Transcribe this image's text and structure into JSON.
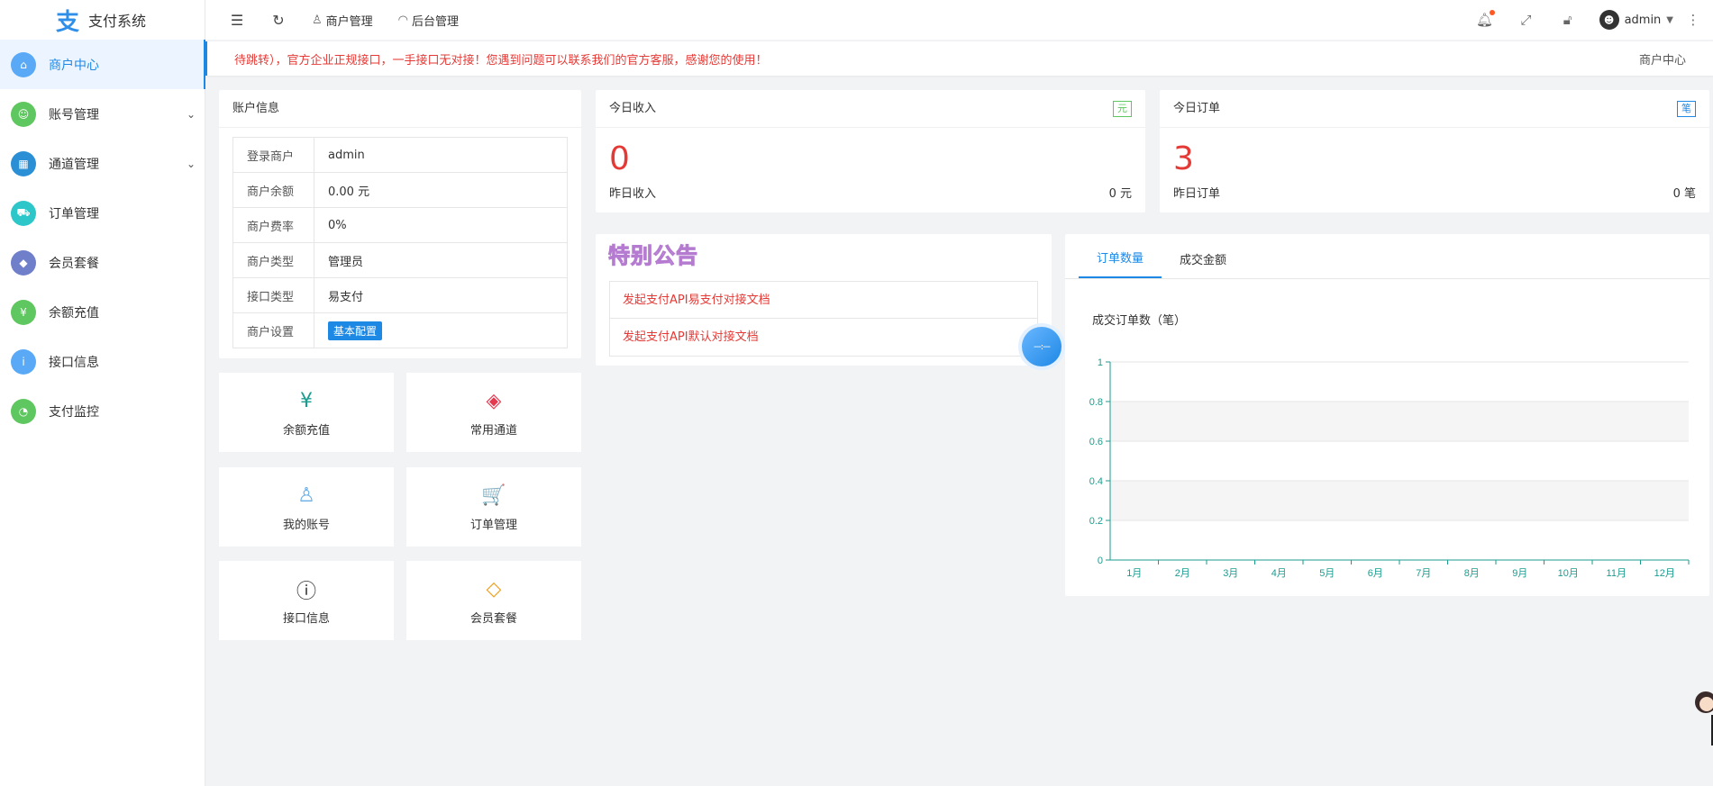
{
  "app": {
    "title": "支付系统",
    "logo_char": "支"
  },
  "sidebar": {
    "items": [
      {
        "label": "商户中心",
        "color": "#5aa9f7",
        "icon": "home-icon",
        "glyph": "⌂",
        "active": true,
        "caret": ""
      },
      {
        "label": "账号管理",
        "color": "#5fc75f",
        "icon": "user-icon",
        "glyph": "☺",
        "active": false,
        "caret": "⌄"
      },
      {
        "label": "通道管理",
        "color": "#2b8fd6",
        "icon": "grid-icon",
        "glyph": "▦",
        "active": false,
        "caret": "⌄"
      },
      {
        "label": "订单管理",
        "color": "#2ec7c9",
        "icon": "cart-icon",
        "glyph": "⛟",
        "active": false,
        "caret": ""
      },
      {
        "label": "会员套餐",
        "color": "#6f7fc9",
        "icon": "diamond-icon",
        "glyph": "◆",
        "active": false,
        "caret": ""
      },
      {
        "label": "余额充值",
        "color": "#5fc75f",
        "icon": "recharge-icon",
        "glyph": "¥",
        "active": false,
        "caret": ""
      },
      {
        "label": "接口信息",
        "color": "#5aa9f7",
        "icon": "info-icon",
        "glyph": "i",
        "active": false,
        "caret": ""
      },
      {
        "label": "支付监控",
        "color": "#5fc75f",
        "icon": "monitor-icon",
        "glyph": "◔",
        "active": false,
        "caret": ""
      }
    ]
  },
  "header": {
    "links": [
      {
        "label": "商户管理",
        "icon": "person-icon",
        "glyph": "♙"
      },
      {
        "label": "后台管理",
        "icon": "dashboard-icon",
        "glyph": "◠"
      }
    ],
    "user": "admin",
    "avatar_glyph": "☻"
  },
  "notice": {
    "text": "待跳转），官方企业正规接口，一手接口无对接！您遇到问题可以联系我们的官方客服，感谢您的使用！",
    "breadcrumb": "商户中心"
  },
  "account": {
    "title": "账户信息",
    "rows": [
      {
        "key": "登录商户",
        "value": "admin"
      },
      {
        "key": "商户余额",
        "value": "0.00 元"
      },
      {
        "key": "商户费率",
        "value": "0%"
      },
      {
        "key": "商户类型",
        "value": "管理员"
      },
      {
        "key": "接口类型",
        "value": "易支付"
      }
    ],
    "settings_key": "商户设置",
    "settings_button": "基本配置"
  },
  "income": {
    "title": "今日收入",
    "tag": "元",
    "tag_color": "#5fc75f",
    "value": "0",
    "foot_label": "昨日收入",
    "foot_value": "0 元"
  },
  "orders": {
    "title": "今日订单",
    "tag": "笔",
    "tag_color": "#1e88e5",
    "value": "3",
    "foot_label": "昨日订单",
    "foot_value": "0 笔"
  },
  "quick": [
    {
      "label": "余额充值",
      "icon": "yuan-icon",
      "glyph": "¥",
      "color": "#1a9d8f"
    },
    {
      "label": "常用通道",
      "icon": "apps-icon",
      "glyph": "◈",
      "color": "#e53950"
    },
    {
      "label": "我的账号",
      "icon": "account-icon",
      "glyph": "♙",
      "color": "#6aaee8"
    },
    {
      "label": "订单管理",
      "icon": "shopping-cart-icon",
      "glyph": "🛒",
      "color": "#5fc75f"
    },
    {
      "label": "接口信息",
      "icon": "info-circle-icon",
      "glyph": "ⓘ",
      "color": "#333"
    },
    {
      "label": "会员套餐",
      "icon": "gem-icon",
      "glyph": "◇",
      "color": "#f0a020"
    }
  ],
  "announcement": {
    "title": "特别公告",
    "links": [
      "发起支付API易支付对接文档",
      "发起支付API默认对接文档"
    ]
  },
  "float_button": "---:---",
  "chart_panel": {
    "tabs": [
      "订单数量",
      "成交金额"
    ],
    "chart_title": "成交订单数（笔）"
  },
  "chart_data": {
    "type": "bar",
    "title": "成交订单数（笔）",
    "xlabel": "",
    "ylabel": "",
    "categories": [
      "1月",
      "2月",
      "3月",
      "4月",
      "5月",
      "6月",
      "7月",
      "8月",
      "9月",
      "10月",
      "11月",
      "12月"
    ],
    "values": [
      0,
      0,
      0,
      0,
      0,
      0,
      0,
      0,
      0,
      0,
      0,
      0
    ],
    "ylim": [
      0,
      1
    ],
    "yticks": [
      "0",
      "0.2",
      "0.4",
      "0.6",
      "0.8",
      "1"
    ],
    "grid": true,
    "axis_color": "#1a9d8f"
  }
}
